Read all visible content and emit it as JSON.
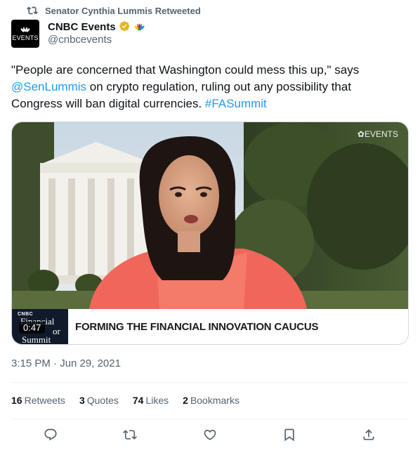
{
  "social_context": {
    "text": "Senator Cynthia Lummis Retweeted",
    "icon": "retweet-icon"
  },
  "author": {
    "display_name": "CNBC Events",
    "handle": "@cnbcevents",
    "avatar_text": "EVENTS",
    "verified_color": "#e2b719"
  },
  "tweet": {
    "part1": "\"People are concerned that Washington could mess this up,\" says ",
    "mention": "@SenLummis",
    "part2": " on crypto regulation, ruling out any possibility that Congress will ban digital currencies. ",
    "hashtag": "#FASummit"
  },
  "media": {
    "watermark": "EVENTS",
    "logo_line1": "CNBC",
    "logo_line2": "Financial",
    "logo_line3": "or",
    "logo_line4": "Summit",
    "duration": "0:47",
    "headline": "FORMING THE FINANCIAL INNOVATION CAUCUS"
  },
  "timestamp": "3:15 PM · Jun 29, 2021",
  "stats": [
    {
      "num": "16",
      "label": "Retweets"
    },
    {
      "num": "3",
      "label": "Quotes"
    },
    {
      "num": "74",
      "label": "Likes"
    },
    {
      "num": "2",
      "label": "Bookmarks"
    }
  ],
  "colors": {
    "link": "#1d9bf0",
    "muted": "#536471",
    "text": "#0f1419"
  }
}
